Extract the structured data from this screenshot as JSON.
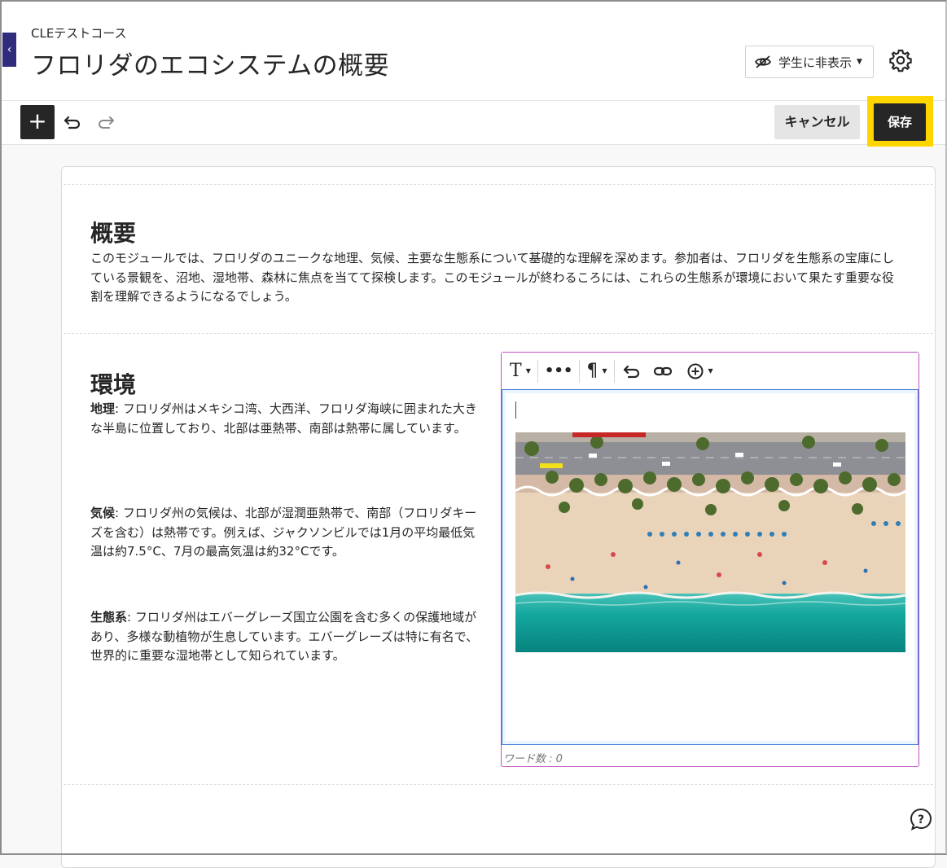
{
  "header": {
    "course_name": "CLEテストコース",
    "page_title": "フロリダのエコシステムの概要",
    "visibility_label": "学生に非表示"
  },
  "toolbar": {
    "add_label": "+",
    "cancel_label": "キャンセル",
    "save_label": "保存"
  },
  "overview": {
    "heading": "概要",
    "body": "このモジュールでは、フロリダのユニークな地理、気候、主要な生態系について基礎的な理解を深めます。参加者は、フロリダを生態系の宝庫にしている景観を、沼地、湿地帯、森林に焦点を当てて探検します。このモジュールが終わるころには、これらの生態系が環境において果たす重要な役割を理解できるようになるでしょう。"
  },
  "environment": {
    "heading": "環境",
    "items": [
      {
        "term": "地理",
        "text": ": フロリダ州はメキシコ湾、大西洋、フロリダ海峡に囲まれた大きな半島に位置しており、北部は亜熱帯、南部は熱帯に属しています。"
      },
      {
        "term": "気候",
        "text": ": フロリダ州の気候は、北部が湿潤亜熱帯で、南部（フロリダキーズを含む）は熱帯です。例えば、ジャクソンビルでは1月の平均最低気温は約7.5°C、7月の最高気温は約32°Cです。"
      },
      {
        "term": "生態系",
        "text": ": フロリダ州はエバーグレーズ国立公園を含む多くの保護地域があり、多様な動植物が生息しています。エバーグレーズは特に有名で、世界的に重要な湿地帯として知られています。"
      }
    ]
  },
  "editor": {
    "word_count": "ワード数 : 0",
    "toolbar_icons": [
      "text-format-icon",
      "more-icon",
      "paragraph-icon",
      "undo-icon",
      "link-icon",
      "insert-icon"
    ]
  },
  "colors": {
    "save_highlight": "#ffd500",
    "editor_border": "#c44fc2",
    "editor_focus": "#3b76d6",
    "back_tab": "#2f2c7d"
  }
}
